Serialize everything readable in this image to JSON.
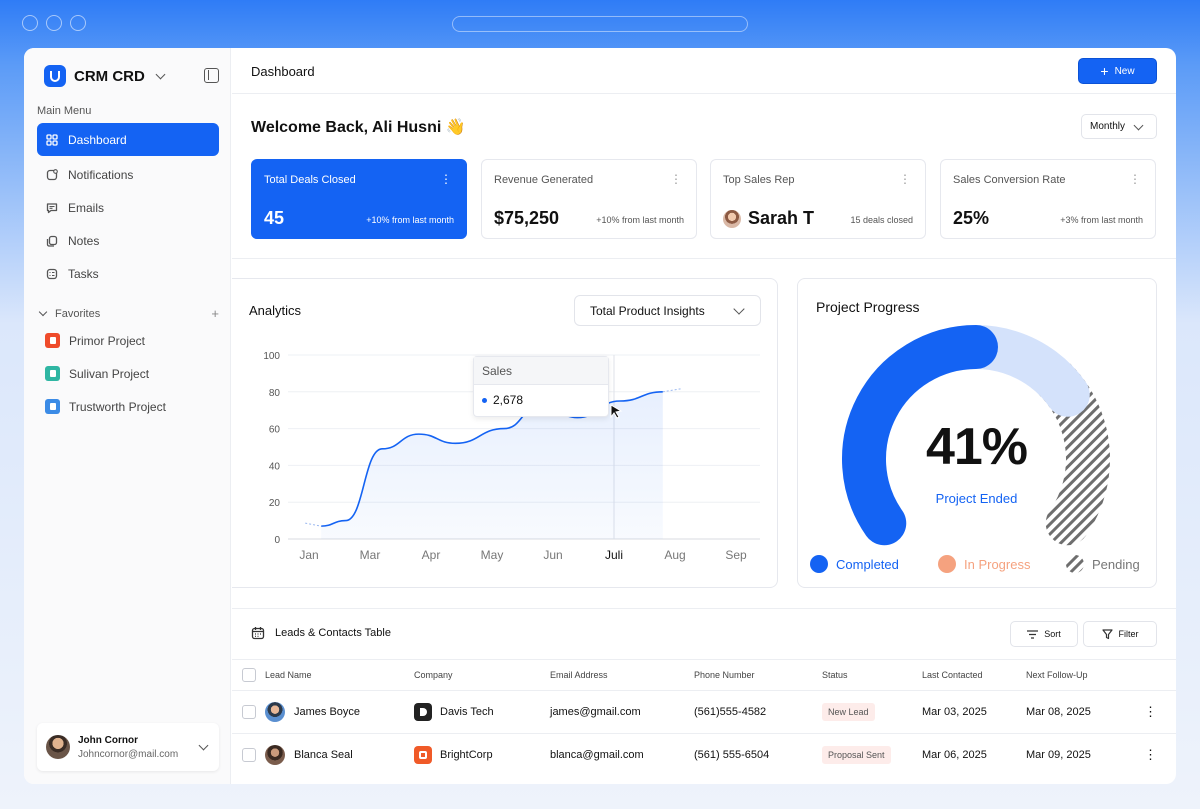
{
  "app": {
    "name": "CRM CRD"
  },
  "sidebar": {
    "menu_label": "Main Menu",
    "items": [
      {
        "label": "Dashboard",
        "icon": "grid-icon",
        "active": true
      },
      {
        "label": "Notifications",
        "icon": "bell-icon"
      },
      {
        "label": "Emails",
        "icon": "message-icon"
      },
      {
        "label": "Notes",
        "icon": "notes-icon"
      },
      {
        "label": "Tasks",
        "icon": "tasks-icon"
      }
    ],
    "favorites_label": "Favorites",
    "favorites": [
      {
        "label": "Primor Project",
        "color": "#ef4b2b"
      },
      {
        "label": "Sulivan Project",
        "color": "#2fb6a3"
      },
      {
        "label": "Trustworth Project",
        "color": "#3b8be6"
      }
    ],
    "user": {
      "name": "John Cornor",
      "email": "Johncornor@mail.com"
    }
  },
  "header": {
    "title": "Dashboard",
    "new_label": "New"
  },
  "welcome": {
    "text": "Welcome Back, Ali Husni 👋",
    "period": "Monthly"
  },
  "kpis": [
    {
      "label": "Total Deals Closed",
      "value": "45",
      "delta": "+10% from last month"
    },
    {
      "label": "Revenue Generated",
      "value": "$75,250",
      "delta": "+10% from last month"
    },
    {
      "label": "Top Sales Rep",
      "value": "Sarah T",
      "delta": "15 deals closed"
    },
    {
      "label": "Sales Conversion Rate",
      "value": "25%",
      "delta": "+3% from last month"
    }
  ],
  "analytics": {
    "title": "Analytics",
    "selector": "Total Product Insights",
    "tooltip": {
      "title": "Sales",
      "value": "2,678"
    }
  },
  "chart_data": {
    "type": "area",
    "categories": [
      "Jan",
      "Mar",
      "Apr",
      "May",
      "Jun",
      "Juli",
      "Aug",
      "Sep"
    ],
    "values": [
      7,
      10,
      49,
      57,
      52,
      60,
      73,
      66,
      75,
      80
    ],
    "x": [
      0.2,
      0.6,
      1.2,
      1.8,
      2.4,
      3.2,
      3.8,
      4.4,
      5.1,
      5.8
    ],
    "ylim": [
      0,
      100
    ],
    "yticks": [
      0,
      20,
      40,
      60,
      80,
      100
    ],
    "highlight_category": "Juli",
    "line_color": "#1463f3"
  },
  "progress": {
    "title": "Project Progress",
    "percent_label": "41%",
    "caption": "Project Ended",
    "completed_fraction": 0.41,
    "legend": [
      {
        "label": "Completed",
        "color": "#1463f3"
      },
      {
        "label": "In Progress",
        "color": "#f5a27f"
      },
      {
        "label": "Pending",
        "color": "#777777"
      }
    ]
  },
  "table": {
    "title": "Leads & Contacts Table",
    "sort_label": "Sort",
    "filter_label": "Filter",
    "columns": [
      "Lead Name",
      "Company",
      "Email Address",
      "Phone Number",
      "Status",
      "Last Contacted",
      "Next Follow-Up"
    ],
    "rows": [
      {
        "name": "James Boyce",
        "company": "Davis Tech",
        "company_color": "#222222",
        "email": "james@gmail.com",
        "phone": "(561)555-4582",
        "status": "New Lead",
        "status_color": "#fdecea",
        "last": "Mar 03, 2025",
        "next": "Mar 08, 2025"
      },
      {
        "name": "Blanca Seal",
        "company": "BrightCorp",
        "company_color": "#f05a28",
        "email": "blanca@gmail.com",
        "phone": "(561) 555-6504",
        "status": "Proposal Sent",
        "status_color": "#fdecea",
        "last": "Mar 06, 2025",
        "next": "Mar 09, 2025"
      }
    ]
  }
}
